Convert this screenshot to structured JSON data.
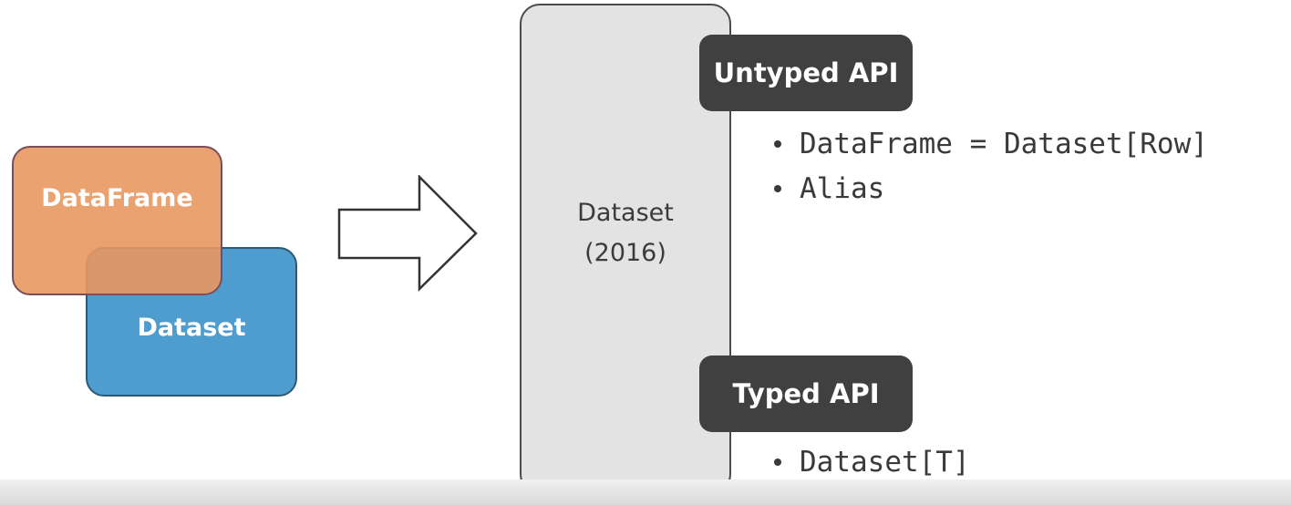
{
  "left_diagram": {
    "dataset_label": "Dataset",
    "dataframe_label": "DataFrame"
  },
  "center": {
    "title": "Dataset",
    "year": "(2016)"
  },
  "untyped_api": {
    "label": "Untyped API",
    "items": [
      "DataFrame = Dataset[Row]",
      "Alias"
    ]
  },
  "typed_api": {
    "label": "Typed API",
    "items": [
      "Dataset[T]"
    ]
  },
  "colors": {
    "dataframe": "#e8985f",
    "dataset": "#4f9cce",
    "pill": "#404040",
    "panel": "#e3e3e3"
  }
}
